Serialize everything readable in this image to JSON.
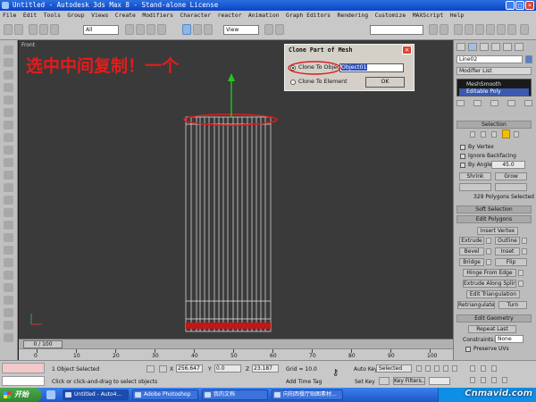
{
  "window": {
    "title": "Untitled - Autodesk 3ds Max 8 - Stand-alone License"
  },
  "menu": [
    "File",
    "Edit",
    "Tools",
    "Group",
    "Views",
    "Create",
    "Modifiers",
    "Character",
    "reactor",
    "Animation",
    "Graph Editors",
    "Rendering",
    "Customize",
    "MAXScript",
    "Help"
  ],
  "toolbar": {
    "filter_value": "All",
    "coord_value": "View"
  },
  "viewport": {
    "label": "Front",
    "annotation": "选中中间复制！一个"
  },
  "dialog": {
    "title": "Clone Part of Mesh",
    "option_object": "Clone To Object:",
    "option_element": "Clone To Element",
    "object_name": "Object01",
    "ok_label": "OK"
  },
  "command_panel": {
    "object_name": "Line02",
    "modifier_list": "Modifier List",
    "stack": [
      "MeshSmooth",
      "Editable Poly"
    ],
    "selection": {
      "header": "Selection",
      "by_vertex": "By Vertex",
      "ignore_backfacing": "Ignore Backfacing",
      "by_angle": "By Angle:",
      "by_angle_value": "45.0",
      "shrink": "Shrink",
      "grow": "Grow",
      "status": "329 Polygons Selected"
    },
    "soft_selection": "Soft Selection",
    "edit_polygons": {
      "header": "Edit Polygons",
      "insert_vertex": "Insert Vertex",
      "extrude": "Extrude",
      "outline": "Outline",
      "bevel": "Bevel",
      "inset": "Inset",
      "bridge": "Bridge",
      "flip": "Flip",
      "hinge": "Hinge From Edge",
      "extrude_spline": "Extrude Along Spline",
      "edit_triangulation": "Edit Triangulation",
      "retriangulate": "Retriangulate",
      "turn": "Turn"
    },
    "edit_geometry": {
      "header": "Edit Geometry",
      "repeat_last": "Repeat Last",
      "constraints": "Constraints:",
      "constraints_value": "None",
      "preserve_uvs": "Preserve UVs"
    }
  },
  "timeline": {
    "frame": "0 / 100",
    "ticks": [
      "0",
      "10",
      "20",
      "30",
      "40",
      "50",
      "60",
      "70",
      "80",
      "90",
      "100"
    ]
  },
  "status": {
    "selection": "1 Object Selected",
    "prompt": "Click or click-and-drag to select objects",
    "x_label": "X",
    "x_value": "256.647",
    "y_label": "Y",
    "y_value": "0.0",
    "z_label": "Z",
    "z_value": "23.187",
    "grid": "Grid = 10.0",
    "add_time_tag": "Add Time Tag",
    "auto_key": "Auto Key",
    "selected": "Selected",
    "set_key": "Set Key",
    "key_filters": "Key Filters..."
  },
  "taskbar": {
    "start": "开始",
    "tasks": [
      "Untitled - Auto4...",
      "Adobe Photoshop",
      "我的文档",
      "向阳西餐厅贴图素材..."
    ]
  },
  "watermark": "Cnmavid.com",
  "colors": {
    "annotation": "#e81a1a",
    "titlebar": "#0a43c8",
    "viewport_bg": "#3a3a3a",
    "wire": "#ffffff"
  }
}
